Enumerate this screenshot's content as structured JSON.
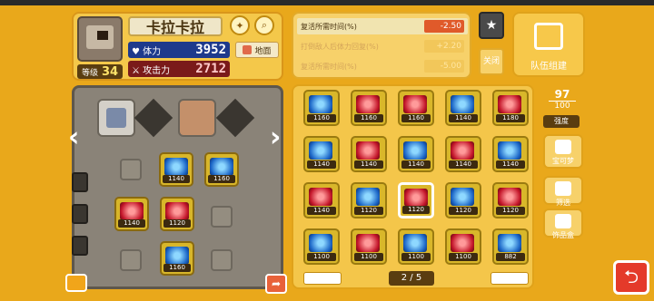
{
  "character": {
    "name": "卡拉卡拉",
    "level_label": "等级",
    "level": "34",
    "hp_label": "体力",
    "hp": "3952",
    "atk_label": "攻击力",
    "atk": "2712",
    "traits_label": "地面"
  },
  "skills": [
    {
      "label": "复活所需时间(%)",
      "value": "-2.50",
      "active": true
    },
    {
      "label": "打倒敌人后体力回复(%)",
      "value": "+2.20",
      "active": false
    },
    {
      "label": "复活所需时间(%)",
      "value": "-5.00",
      "active": false
    }
  ],
  "close_label": "关闭",
  "team_label": "队伍组建",
  "capacity": {
    "current": "97",
    "max": "100"
  },
  "strength_label": "强度",
  "side_buttons": [
    {
      "label": "宝可梦"
    },
    {
      "label": "筛选"
    },
    {
      "label": "饰品盒"
    }
  ],
  "slots": [
    {
      "color": "blue",
      "value": "1140"
    },
    {
      "color": "blue",
      "value": "1160"
    },
    {
      "color": "red",
      "value": "1140"
    },
    {
      "color": "red",
      "value": "1120"
    },
    {
      "color": "blue",
      "value": "1160"
    }
  ],
  "inventory": [
    {
      "color": "blue",
      "value": "1160"
    },
    {
      "color": "red",
      "value": "1160"
    },
    {
      "color": "red",
      "value": "1160"
    },
    {
      "color": "blue",
      "value": "1140"
    },
    {
      "color": "red",
      "value": "1180"
    },
    {
      "color": "blue",
      "value": "1140"
    },
    {
      "color": "red",
      "value": "1140"
    },
    {
      "color": "blue",
      "value": "1140"
    },
    {
      "color": "red",
      "value": "1140"
    },
    {
      "color": "blue",
      "value": "1140"
    },
    {
      "color": "red",
      "value": "1140"
    },
    {
      "color": "blue",
      "value": "1120"
    },
    {
      "color": "red",
      "value": "1120"
    },
    {
      "color": "blue",
      "value": "1120"
    },
    {
      "color": "red",
      "value": "1120"
    },
    {
      "color": "blue",
      "value": "1100"
    },
    {
      "color": "red",
      "value": "1100"
    },
    {
      "color": "blue",
      "value": "1100"
    },
    {
      "color": "red",
      "value": "1100"
    },
    {
      "color": "blue",
      "value": "882"
    }
  ],
  "page": "2 / 5"
}
